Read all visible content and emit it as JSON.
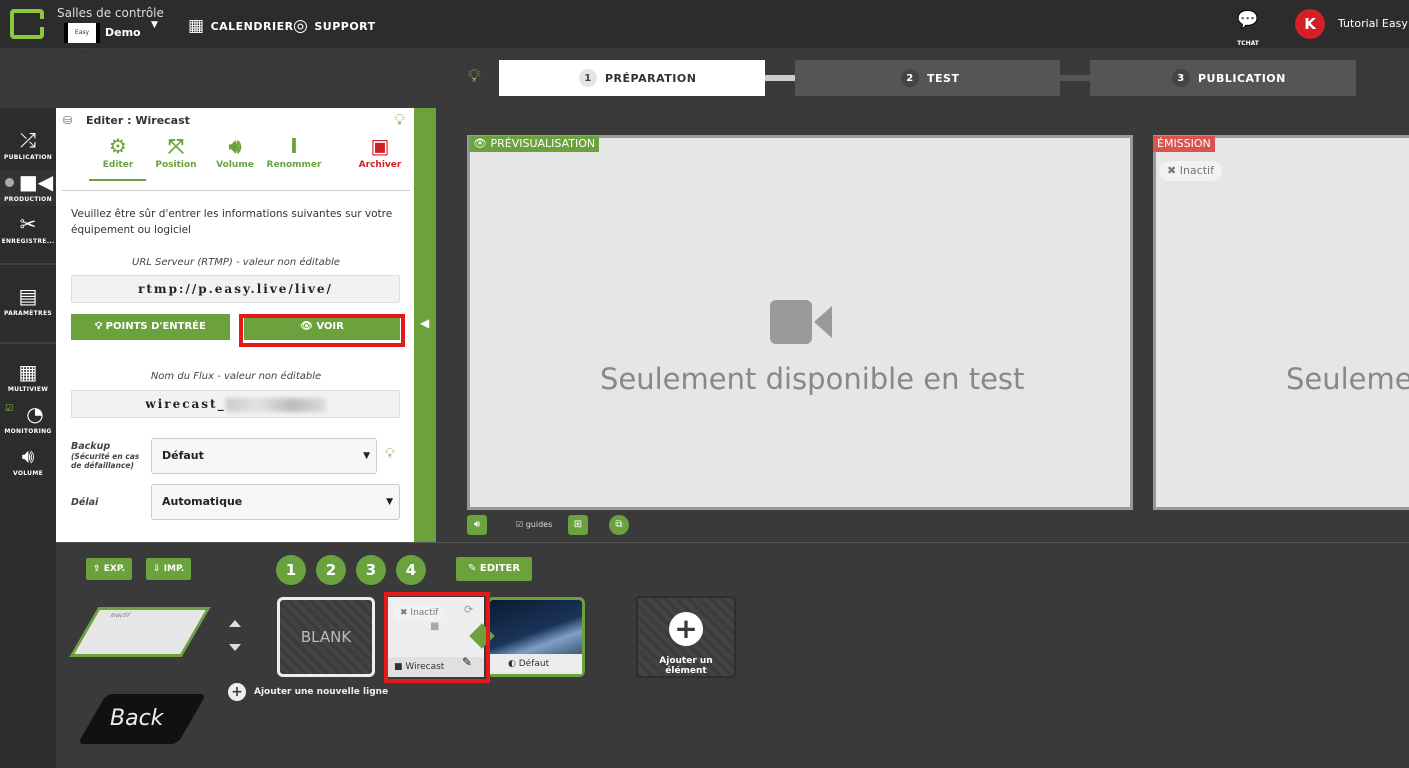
{
  "header": {
    "room_title": "Salles de contrôle",
    "room_logo_text": "Easy Live",
    "room_name": "Demo",
    "nav": [
      {
        "label": "CALENDRIER",
        "icon": "calendar-icon"
      },
      {
        "label": "SUPPORT",
        "icon": "lifebuoy-icon"
      }
    ],
    "chat_label": "TCHAT",
    "avatar_letter": "K",
    "username": "Tutorial Easy L"
  },
  "steps": [
    {
      "num": "1",
      "label": "PRÉPARATION",
      "active": true
    },
    {
      "num": "2",
      "label": "TEST",
      "active": false
    },
    {
      "num": "3",
      "label": "PUBLICATION",
      "active": false
    }
  ],
  "sidebar": [
    {
      "label": "PUBLICATION",
      "icon": "shuffle-icon"
    },
    {
      "label": "PRODUCTION",
      "icon": "video-camera-icon"
    },
    {
      "label": "ENREGISTRE...",
      "icon": "scissors-icon"
    },
    {
      "label": "PARAMÈTRES",
      "icon": "newspaper-icon"
    },
    {
      "label": "MULTIVIEW",
      "icon": "grid-icon"
    },
    {
      "label": "MONITORING",
      "icon": "gauge-icon"
    },
    {
      "label": "VOLUME",
      "icon": "speaker-icon"
    }
  ],
  "editor": {
    "title": "Editer : Wirecast",
    "tabs": [
      {
        "label": "Editer",
        "icon": "gear-icon"
      },
      {
        "label": "Position",
        "icon": "expand-arrows-icon"
      },
      {
        "label": "Volume",
        "icon": "speaker-icon"
      },
      {
        "label": "Renommer",
        "icon": "text-cursor-icon"
      },
      {
        "label": "Archiver",
        "icon": "archive-box-icon"
      }
    ],
    "info": "Veuillez être sûr d'entrer les informations suivantes sur votre équipement ou logiciel",
    "rtmp_label": "URL Serveur (RTMP) - valeur non éditable",
    "rtmp_value": "rtmp://p.easy.live/live/",
    "btn_inputs": "POINTS D'ENTRÉE",
    "btn_view": "VOIR",
    "stream_label": "Nom du Flux - valeur non éditable",
    "stream_value": "wirecast_",
    "backup_label": "Backup",
    "backup_sub": "(Sécurité en cas de défaillance)",
    "backup_value": "Défaut",
    "delay_label": "Délai",
    "delay_value": "Automatique"
  },
  "preview": {
    "preview_tag": "PRÉVISUALISATION",
    "emission_tag": "ÉMISSION",
    "message": "Seulement disponible en test",
    "message_cut": "Seulemen",
    "inactive": "Inactif",
    "guides": "guides"
  },
  "bottom": {
    "export": "EXP.",
    "import": "IMP.",
    "layers": [
      "1",
      "2",
      "3",
      "4"
    ],
    "edit": "EDITER",
    "back_label": "Back",
    "blank_label": "BLANK",
    "source_label": "Wirecast",
    "source_inactive": "Inactif",
    "default_label": "Défaut",
    "add_element": "Ajouter un élément",
    "add_line": "Ajouter une nouvelle ligne"
  },
  "colors": {
    "accent": "#6ba23d",
    "emission": "#d9534f",
    "highlight": "#e31a1a"
  }
}
